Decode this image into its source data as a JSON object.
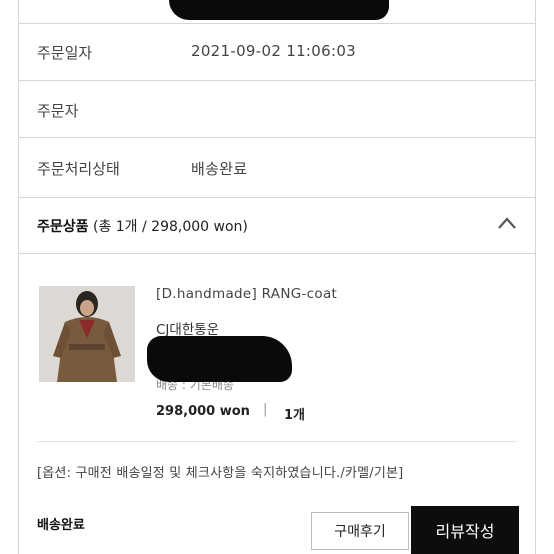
{
  "order_info": {
    "date_label": "주문일자",
    "date_value": "2021-09-02 11:06:03",
    "orderer_label": "주문자",
    "orderer_value": "",
    "status_label": "주문처리상태",
    "status_value": "배송완료"
  },
  "products_section": {
    "title_bold": "주문상품",
    "title_summary": "(총 1개 / 298,000 won)",
    "collapse_icon": "chevron-up-icon"
  },
  "product": {
    "name": "[D.handmade] RANG-coat",
    "carrier": "CJ대한통운",
    "shipping": "배송 : 기본배송",
    "price": "298,000 won",
    "separator": "|",
    "quantity": "1개",
    "option": "[옵션: 구매전 배송일정 및 체크사항을 숙지하였습니다./카멜/기본]"
  },
  "footer": {
    "status": "배송완료",
    "review_buy_label": "구매후기",
    "write_review_label": "리뷰작성"
  }
}
